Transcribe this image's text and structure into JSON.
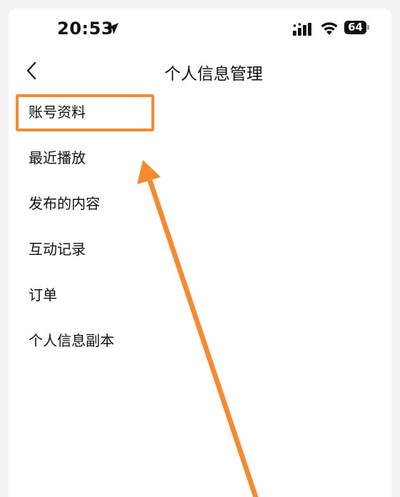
{
  "status_bar": {
    "time": "20:53",
    "battery_level": "64",
    "icons": [
      "location-arrow-icon",
      "signal-icon",
      "wifi-icon",
      "battery-icon"
    ]
  },
  "nav": {
    "back_icon": "chevron-left-icon",
    "title": "个人信息管理"
  },
  "menu": {
    "items": [
      {
        "label": "账号资料"
      },
      {
        "label": "最近播放"
      },
      {
        "label": "发布的内容"
      },
      {
        "label": "互动记录"
      },
      {
        "label": "订单"
      },
      {
        "label": "个人信息副本"
      }
    ]
  },
  "annotation": {
    "color": "#f58a2e",
    "highlighted_item": "账号资料"
  }
}
